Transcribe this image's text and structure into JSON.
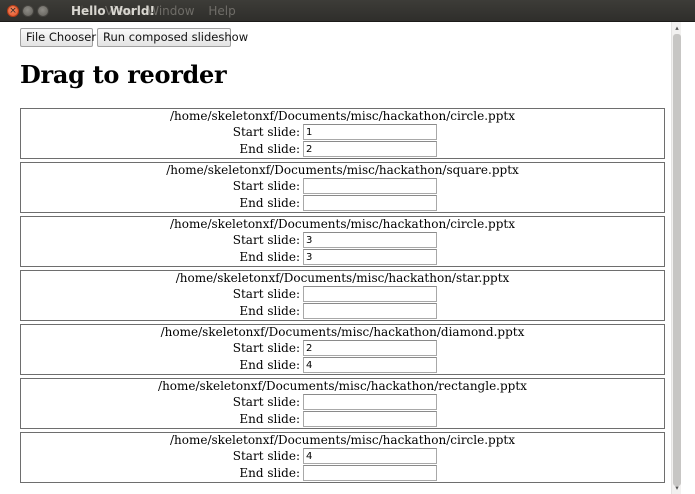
{
  "window": {
    "title": "Hello World!",
    "menu": [
      "File",
      "View",
      "Window",
      "Help"
    ],
    "close_glyph": "×",
    "close_icon": "close-icon",
    "minimize_icon": "minimize-icon",
    "maximize_icon": "maximize-icon"
  },
  "toolbar": {
    "file_chooser_label": "File Chooser",
    "run_label": "Run composed slideshow"
  },
  "page": {
    "heading": "Drag to reorder"
  },
  "slides": [
    {
      "path": "/home/skeletonxf/Documents/misc/hackathon/circle.pptx",
      "start_label": "Start slide:",
      "start_value": "1",
      "end_label": "End slide:",
      "end_value": "2"
    },
    {
      "path": "/home/skeletonxf/Documents/misc/hackathon/square.pptx",
      "start_label": "Start slide:",
      "start_value": "",
      "end_label": "End slide:",
      "end_value": ""
    },
    {
      "path": "/home/skeletonxf/Documents/misc/hackathon/circle.pptx",
      "start_label": "Start slide:",
      "start_value": "3",
      "end_label": "End slide:",
      "end_value": "3"
    },
    {
      "path": "/home/skeletonxf/Documents/misc/hackathon/star.pptx",
      "start_label": "Start slide:",
      "start_value": "",
      "end_label": "End slide:",
      "end_value": ""
    },
    {
      "path": "/home/skeletonxf/Documents/misc/hackathon/diamond.pptx",
      "start_label": "Start slide:",
      "start_value": "2",
      "end_label": "End slide:",
      "end_value": "4"
    },
    {
      "path": "/home/skeletonxf/Documents/misc/hackathon/rectangle.pptx",
      "start_label": "Start slide:",
      "start_value": "",
      "end_label": "End slide:",
      "end_value": ""
    },
    {
      "path": "/home/skeletonxf/Documents/misc/hackathon/circle.pptx",
      "start_label": "Start slide:",
      "start_value": "4",
      "end_label": "End slide:",
      "end_value": ""
    }
  ],
  "scrollbar": {
    "up_glyph": "▴",
    "down_glyph": "▾"
  },
  "colors": {
    "titlebar": "#3d3c38",
    "close_button": "#e0522a",
    "item_border": "#6e6e6e"
  }
}
